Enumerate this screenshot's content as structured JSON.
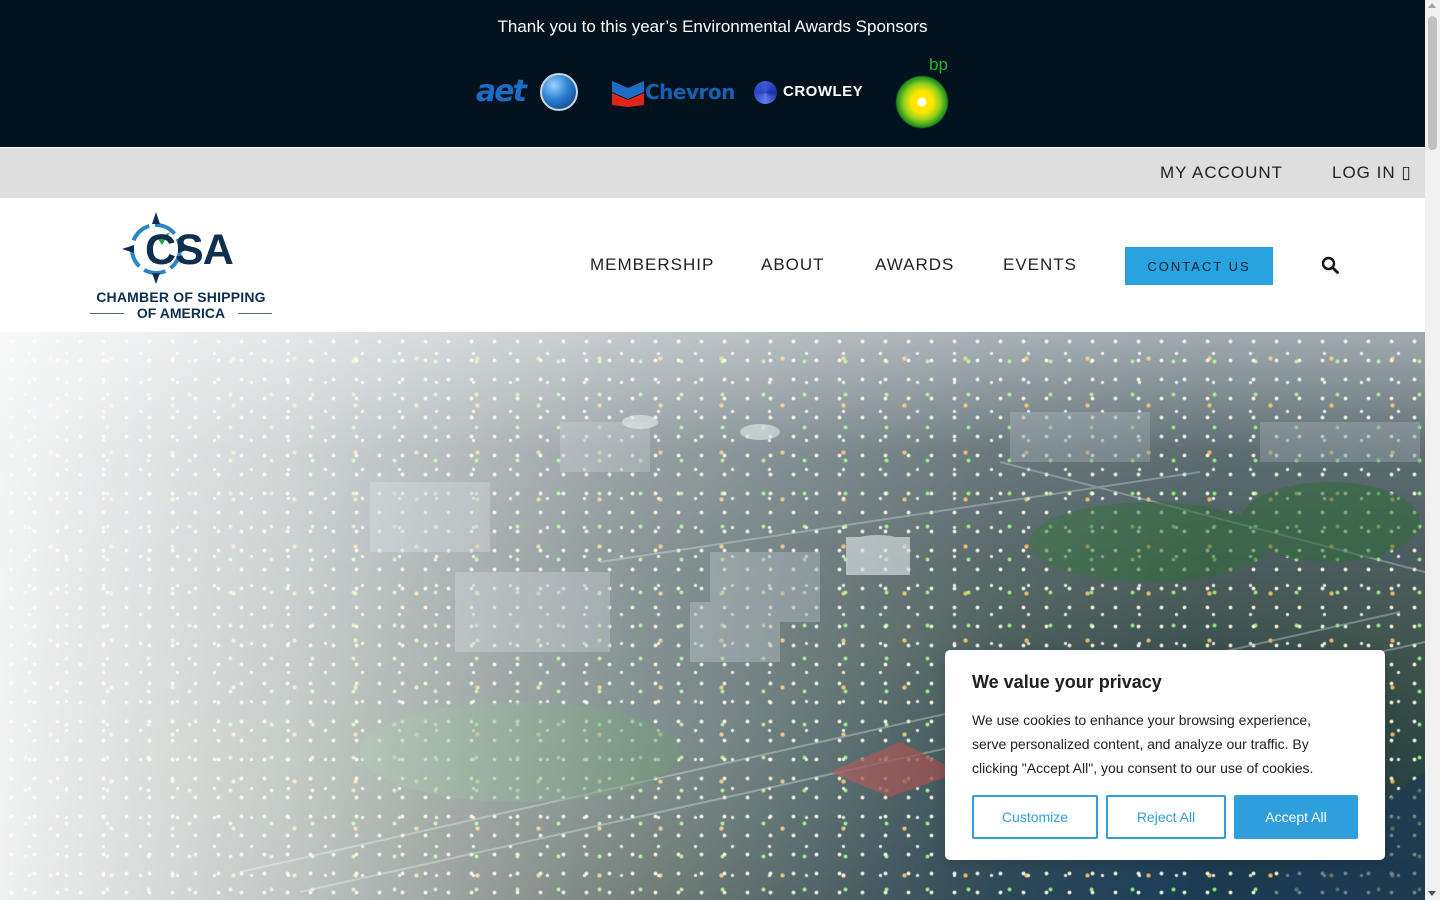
{
  "sponsors": {
    "title": "Thank you to this year’s Environmental Awards Sponsors",
    "logos": {
      "aet": "aet",
      "chevron": "Chevron",
      "crowley": "CROWLEY",
      "bp": "bp"
    }
  },
  "account_bar": {
    "my_account": "MY ACCOUNT",
    "log_in": "LOG IN ▯"
  },
  "header": {
    "logo": {
      "mark_text": "CSA",
      "line1": "CHAMBER OF SHIPPING",
      "line2": "OF AMERICA"
    },
    "nav": {
      "membership": "MEMBERSHIP",
      "about": "ABOUT",
      "awards": "AWARDS",
      "events": "EVENTS"
    },
    "contact_button": "CONTACT US",
    "search_icon": "search-icon"
  },
  "cookie_banner": {
    "title": "We value your privacy",
    "text": "We use cookies to enhance your browsing experience, serve personalized content, and analyze our traffic. By clicking \"Accept All\", you consent to our use of cookies.",
    "customize": "Customize",
    "reject_all": "Reject All",
    "accept_all": "Accept All"
  },
  "colors": {
    "banner_bg": "#02131f",
    "account_bar_bg": "#dedede",
    "accent": "#29a3e0",
    "brand_navy": "#0e2f4f"
  }
}
